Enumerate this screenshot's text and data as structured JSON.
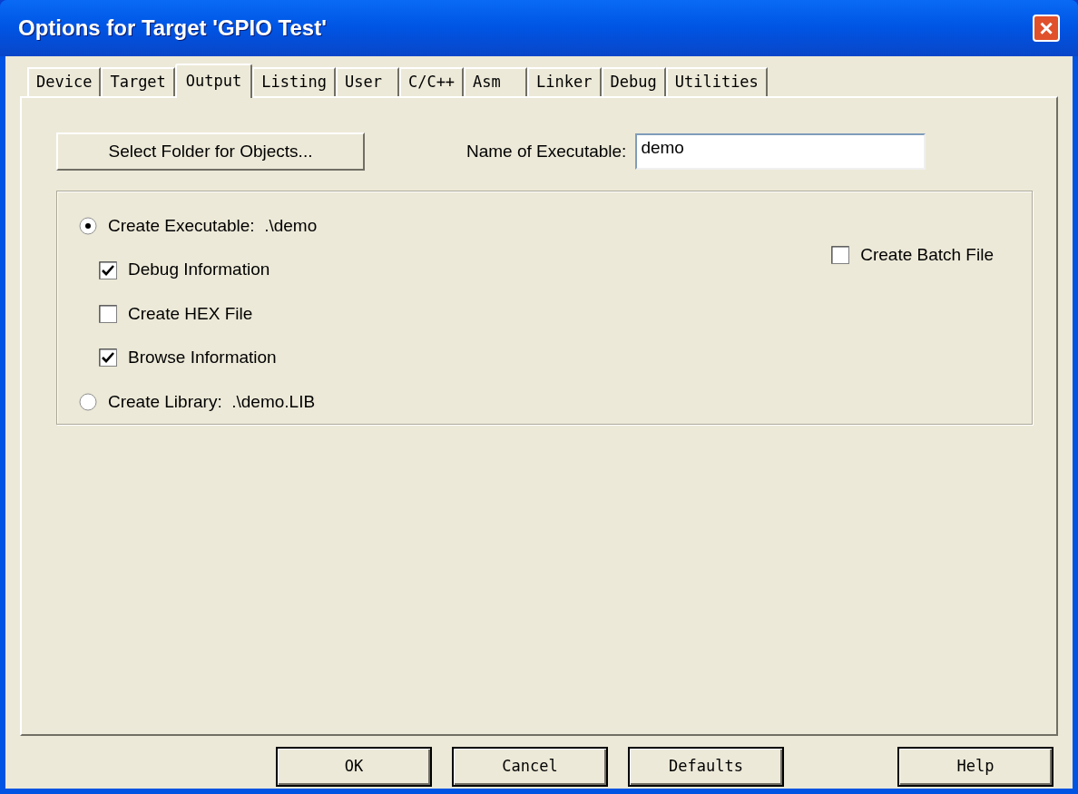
{
  "window": {
    "title": "Options for Target 'GPIO Test'",
    "close": "×"
  },
  "tabs": [
    {
      "label": "Device",
      "selected": false
    },
    {
      "label": "Target",
      "selected": false
    },
    {
      "label": "Output",
      "selected": true
    },
    {
      "label": "Listing",
      "selected": false
    },
    {
      "label": "User",
      "selected": false
    },
    {
      "label": "C/C++",
      "selected": false
    },
    {
      "label": "Asm",
      "selected": false
    },
    {
      "label": "Linker",
      "selected": false
    },
    {
      "label": "Debug",
      "selected": false
    },
    {
      "label": "Utilities",
      "selected": false
    }
  ],
  "select_folder_button": "Select Folder for Objects...",
  "executable_name": {
    "label": "Name of Executable:",
    "value": "demo"
  },
  "options": [
    {
      "kind": "radio",
      "label": "Create Executable:  .\\demo",
      "selected": true
    },
    {
      "kind": "checkbox",
      "label": "Debug Information",
      "checked": true
    },
    {
      "kind": "checkbox",
      "label": "Create HEX File",
      "checked": false
    },
    {
      "kind": "checkbox",
      "label": "Browse Information",
      "checked": true
    },
    {
      "kind": "radio",
      "label": "Create Library:  .\\demo.LIB",
      "selected": false
    }
  ],
  "batch_file": {
    "label": "Create Batch File",
    "checked": false
  },
  "buttons": [
    "OK",
    "Cancel",
    "Defaults",
    "Help"
  ]
}
